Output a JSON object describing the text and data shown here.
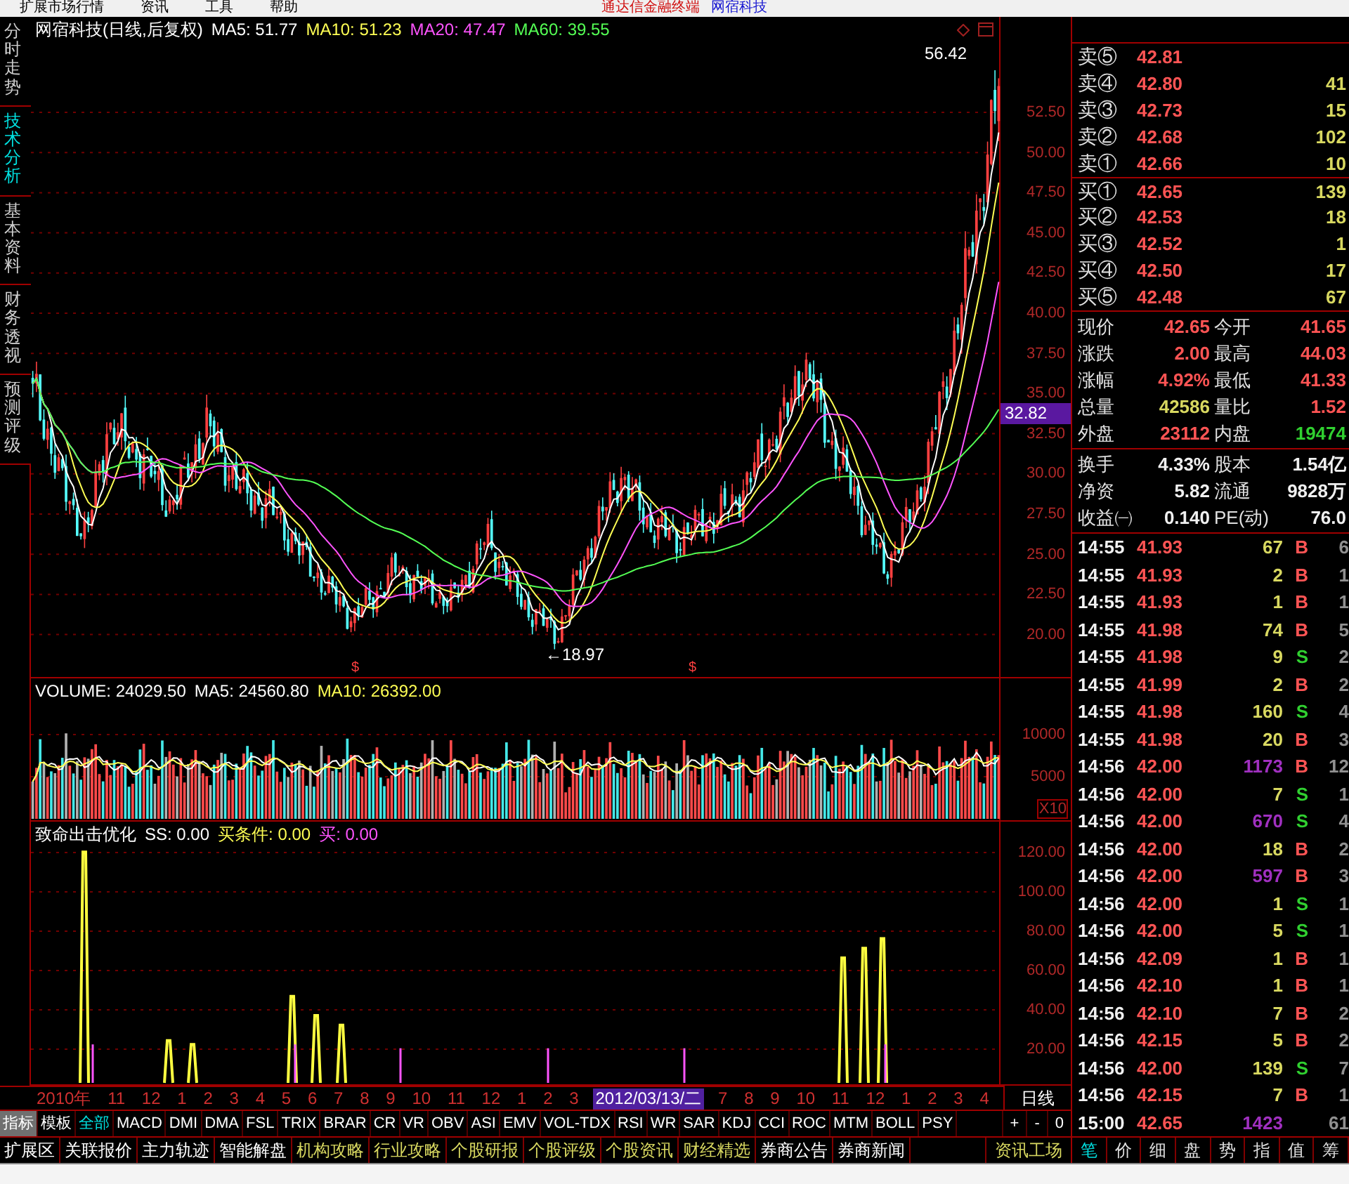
{
  "menu": [
    {
      "label": "扩展市场行情"
    },
    {
      "label": "资讯"
    },
    {
      "label": "工具"
    },
    {
      "label": "帮助"
    }
  ],
  "title": {
    "app": "通达信金融终端",
    "stock": "网宿科技"
  },
  "side_tabs": [
    {
      "label": "分时走势",
      "selected": false
    },
    {
      "label": "技术分析",
      "selected": true
    },
    {
      "label": "基本资料",
      "selected": false
    },
    {
      "label": "财务透视",
      "selected": false
    },
    {
      "label": "预测评级",
      "selected": false
    }
  ],
  "price_panel": {
    "legend": [
      {
        "text": "网宿科技(日线,后复权)",
        "color": "#ffffff"
      },
      {
        "text": "MA5: 51.77",
        "color": "#ffffff"
      },
      {
        "text": "MA10: 51.23",
        "color": "#ffff54"
      },
      {
        "text": "MA20: 47.47",
        "color": "#ff54ff"
      },
      {
        "text": "MA60: 39.55",
        "color": "#54ff54"
      }
    ],
    "high_label": "56.42",
    "low_label": "←18.97",
    "markers": [
      "$",
      "$"
    ],
    "axis": [
      "52.50",
      "50.00",
      "47.50",
      "45.00",
      "42.50",
      "40.00",
      "37.50",
      "35.00",
      "32.50",
      "30.00",
      "27.50",
      "25.00",
      "22.50",
      "20.00"
    ],
    "current_price": "32.82"
  },
  "volume_panel": {
    "legend": [
      {
        "text": "VOLUME: 24029.50",
        "color": "#ffffff"
      },
      {
        "text": "MA5: 24560.80",
        "color": "#ffffff"
      },
      {
        "text": "MA10: 26392.00",
        "color": "#ffff54"
      }
    ],
    "axis": [
      "10000",
      "5000"
    ],
    "unit": "X10"
  },
  "indicator_panel": {
    "legend": [
      {
        "text": "致命出击优化",
        "color": "#ffffff"
      },
      {
        "text": "SS: 0.00",
        "color": "#ffffff"
      },
      {
        "text": "买条件: 0.00",
        "color": "#ffff54"
      },
      {
        "text": "买: 0.00",
        "color": "#ff54ff"
      }
    ],
    "axis": [
      "120.00",
      "100.00",
      "80.00",
      "60.00",
      "40.00",
      "20.00"
    ]
  },
  "date_axis": {
    "labels": [
      {
        "text": "2010年",
        "selected": false
      },
      {
        "text": "11",
        "selected": false
      },
      {
        "text": "12",
        "selected": false
      },
      {
        "text": "1",
        "selected": false
      },
      {
        "text": "2",
        "selected": false
      },
      {
        "text": "3",
        "selected": false
      },
      {
        "text": "4",
        "selected": false
      },
      {
        "text": "5",
        "selected": false
      },
      {
        "text": "6",
        "selected": false
      },
      {
        "text": "7",
        "selected": false
      },
      {
        "text": "8",
        "selected": false
      },
      {
        "text": "9",
        "selected": false
      },
      {
        "text": "10",
        "selected": false
      },
      {
        "text": "11",
        "selected": false
      },
      {
        "text": "12",
        "selected": false
      },
      {
        "text": "1",
        "selected": false
      },
      {
        "text": "2",
        "selected": false
      },
      {
        "text": "3",
        "selected": false
      },
      {
        "text": "2012/03/13/二",
        "selected": true
      },
      {
        "text": "7",
        "selected": false
      },
      {
        "text": "8",
        "selected": false
      },
      {
        "text": "9",
        "selected": false
      },
      {
        "text": "10",
        "selected": false
      },
      {
        "text": "11",
        "selected": false
      },
      {
        "text": "12",
        "selected": false
      },
      {
        "text": "1",
        "selected": false
      },
      {
        "text": "2",
        "selected": false
      },
      {
        "text": "3",
        "selected": false
      },
      {
        "text": "4",
        "selected": false
      }
    ],
    "period": "日线"
  },
  "indicator_tabs": [
    {
      "label": "指标",
      "selected": true,
      "highlighted": false
    },
    {
      "label": "模板",
      "selected": false,
      "highlighted": false
    },
    {
      "label": "全部",
      "selected": false,
      "highlighted": true
    },
    {
      "label": "MACD",
      "selected": false,
      "highlighted": false
    },
    {
      "label": "DMI",
      "selected": false,
      "highlighted": false
    },
    {
      "label": "DMA",
      "selected": false,
      "highlighted": false
    },
    {
      "label": "FSL",
      "selected": false,
      "highlighted": false
    },
    {
      "label": "TRIX",
      "selected": false,
      "highlighted": false
    },
    {
      "label": "BRAR",
      "selected": false,
      "highlighted": false
    },
    {
      "label": "CR",
      "selected": false,
      "highlighted": false
    },
    {
      "label": "VR",
      "selected": false,
      "highlighted": false
    },
    {
      "label": "OBV",
      "selected": false,
      "highlighted": false
    },
    {
      "label": "ASI",
      "selected": false,
      "highlighted": false
    },
    {
      "label": "EMV",
      "selected": false,
      "highlighted": false
    },
    {
      "label": "VOL-TDX",
      "selected": false,
      "highlighted": false
    },
    {
      "label": "RSI",
      "selected": false,
      "highlighted": false
    },
    {
      "label": "WR",
      "selected": false,
      "highlighted": false
    },
    {
      "label": "SAR",
      "selected": false,
      "highlighted": false
    },
    {
      "label": "KDJ",
      "selected": false,
      "highlighted": false
    },
    {
      "label": "CCI",
      "selected": false,
      "highlighted": false
    },
    {
      "label": "ROC",
      "selected": false,
      "highlighted": false
    },
    {
      "label": "MTM",
      "selected": false,
      "highlighted": false
    },
    {
      "label": "BOLL",
      "selected": false,
      "highlighted": false
    },
    {
      "label": "PSY",
      "selected": false,
      "highlighted": false
    }
  ],
  "zoom_buttons": [
    "+",
    "-",
    "0"
  ],
  "bottom_tabs": [
    {
      "label": "扩展区",
      "highlighted": false
    },
    {
      "label": "关联报价",
      "highlighted": false
    },
    {
      "label": "主力轨迹",
      "highlighted": false
    },
    {
      "label": "智能解盘",
      "highlighted": false
    },
    {
      "label": "机构攻略",
      "highlighted": true
    },
    {
      "label": "行业攻略",
      "highlighted": true
    },
    {
      "label": "个股研报",
      "highlighted": true
    },
    {
      "label": "个股评级",
      "highlighted": true
    },
    {
      "label": "个股资讯",
      "highlighted": true
    },
    {
      "label": "财经精选",
      "highlighted": true
    },
    {
      "label": "券商公告",
      "highlighted": false
    },
    {
      "label": "券商新闻",
      "highlighted": false
    }
  ],
  "info_button": "资讯工场",
  "order_book": [
    {
      "label": "卖⑤",
      "price": "42.81"
    },
    {
      "label": "卖④",
      "price": "42.80",
      "volume": "41"
    },
    {
      "label": "卖③",
      "price": "42.73",
      "volume": "15"
    },
    {
      "label": "卖②",
      "price": "42.68",
      "volume": "102"
    },
    {
      "label": "卖①",
      "price": "42.66",
      "volume": "10"
    },
    {
      "label": "买①",
      "price": "42.65",
      "volume": "139"
    },
    {
      "label": "买②",
      "price": "42.53",
      "volume": "18"
    },
    {
      "label": "买③",
      "price": "42.52",
      "volume": "1"
    },
    {
      "label": "买④",
      "price": "42.50",
      "volume": "17"
    },
    {
      "label": "买⑤",
      "price": "42.48",
      "volume": "67"
    }
  ],
  "quote_stats": [
    [
      {
        "label": "现价",
        "value": "42.65",
        "color": "#ff5454"
      },
      {
        "label": "今开",
        "value": "41.65",
        "color": "#ff5454"
      }
    ],
    [
      {
        "label": "涨跌",
        "value": "2.00",
        "color": "#ff5454"
      },
      {
        "label": "最高",
        "value": "44.03",
        "color": "#ff5454"
      }
    ],
    [
      {
        "label": "涨幅",
        "value": "4.92%",
        "color": "#ff5454"
      },
      {
        "label": "最低",
        "value": "41.33",
        "color": "#ff5454"
      }
    ],
    [
      {
        "label": "总量",
        "value": "42586",
        "color": "#d8d860"
      },
      {
        "label": "量比",
        "value": "1.52",
        "color": "#ff5454"
      }
    ],
    [
      {
        "label": "外盘",
        "value": "23112",
        "color": "#ff5454"
      },
      {
        "label": "内盘",
        "value": "19474",
        "color": "#30d030"
      }
    ]
  ],
  "share_stats": [
    [
      {
        "label": "换手",
        "value": "4.33%"
      },
      {
        "label": "股本",
        "value": "1.54亿"
      }
    ],
    [
      {
        "label": "净资",
        "value": "5.82"
      },
      {
        "label": "流通",
        "value": "9828万"
      }
    ],
    [
      {
        "label": "收益㈠",
        "value": "0.140"
      },
      {
        "label": "PE(动)",
        "value": "76.0"
      }
    ]
  ],
  "trades": [
    {
      "time": "14:55",
      "price": "41.93",
      "volume": "67",
      "large": false,
      "side": "B",
      "kind": "buy",
      "column_5": "6"
    },
    {
      "time": "14:55",
      "price": "41.93",
      "volume": "2",
      "large": false,
      "side": "B",
      "kind": "buy",
      "column_5": "1"
    },
    {
      "time": "14:55",
      "price": "41.93",
      "volume": "1",
      "large": false,
      "side": "B",
      "kind": "buy",
      "column_5": "1"
    },
    {
      "time": "14:55",
      "price": "41.98",
      "volume": "74",
      "large": false,
      "side": "B",
      "kind": "buy",
      "column_5": "5"
    },
    {
      "time": "14:55",
      "price": "41.98",
      "volume": "9",
      "large": false,
      "side": "S",
      "kind": "sell",
      "column_5": "2"
    },
    {
      "time": "14:55",
      "price": "41.99",
      "volume": "2",
      "large": false,
      "side": "B",
      "kind": "buy",
      "column_5": "2"
    },
    {
      "time": "14:55",
      "price": "41.98",
      "volume": "160",
      "large": false,
      "side": "S",
      "kind": "sell",
      "column_5": "4"
    },
    {
      "time": "14:55",
      "price": "41.98",
      "volume": "20",
      "large": false,
      "side": "B",
      "kind": "buy",
      "column_5": "3"
    },
    {
      "time": "14:56",
      "price": "42.00",
      "volume": "1173",
      "large": true,
      "side": "B",
      "kind": "buy",
      "column_5": "12"
    },
    {
      "time": "14:56",
      "price": "42.00",
      "volume": "7",
      "large": false,
      "side": "S",
      "kind": "sell",
      "column_5": "1"
    },
    {
      "time": "14:56",
      "price": "42.00",
      "volume": "670",
      "large": true,
      "side": "S",
      "kind": "sell",
      "column_5": "4"
    },
    {
      "time": "14:56",
      "price": "42.00",
      "volume": "18",
      "large": false,
      "side": "B",
      "kind": "buy",
      "column_5": "2"
    },
    {
      "time": "14:56",
      "price": "42.00",
      "volume": "597",
      "large": true,
      "side": "B",
      "kind": "buy",
      "column_5": "3"
    },
    {
      "time": "14:56",
      "price": "42.00",
      "volume": "1",
      "large": false,
      "side": "S",
      "kind": "sell",
      "column_5": "1"
    },
    {
      "time": "14:56",
      "price": "42.00",
      "volume": "5",
      "large": false,
      "side": "S",
      "kind": "sell",
      "column_5": "1"
    },
    {
      "time": "14:56",
      "price": "42.09",
      "volume": "1",
      "large": false,
      "side": "B",
      "kind": "buy",
      "column_5": "1"
    },
    {
      "time": "14:56",
      "price": "42.10",
      "volume": "1",
      "large": false,
      "side": "B",
      "kind": "buy",
      "column_5": "1"
    },
    {
      "time": "14:56",
      "price": "42.10",
      "volume": "7",
      "large": false,
      "side": "B",
      "kind": "buy",
      "column_5": "2"
    },
    {
      "time": "14:56",
      "price": "42.15",
      "volume": "5",
      "large": false,
      "side": "B",
      "kind": "buy",
      "column_5": "2"
    },
    {
      "time": "14:56",
      "price": "42.00",
      "volume": "139",
      "large": false,
      "side": "S",
      "kind": "sell",
      "column_5": "7"
    },
    {
      "time": "14:56",
      "price": "42.15",
      "volume": "7",
      "large": false,
      "side": "B",
      "kind": "buy",
      "column_5": "1"
    },
    {
      "time": "15:00",
      "price": "42.65",
      "volume": "1423",
      "large": true,
      "column_5": "61"
    }
  ],
  "panel_tabs": [
    {
      "label": "笔",
      "selected": true
    },
    {
      "label": "价",
      "selected": false
    },
    {
      "label": "细",
      "selected": false
    },
    {
      "label": "盘",
      "selected": false
    },
    {
      "label": "势",
      "selected": false
    },
    {
      "label": "指",
      "selected": false
    },
    {
      "label": "值",
      "selected": false
    },
    {
      "label": "筹",
      "selected": false
    }
  ]
}
